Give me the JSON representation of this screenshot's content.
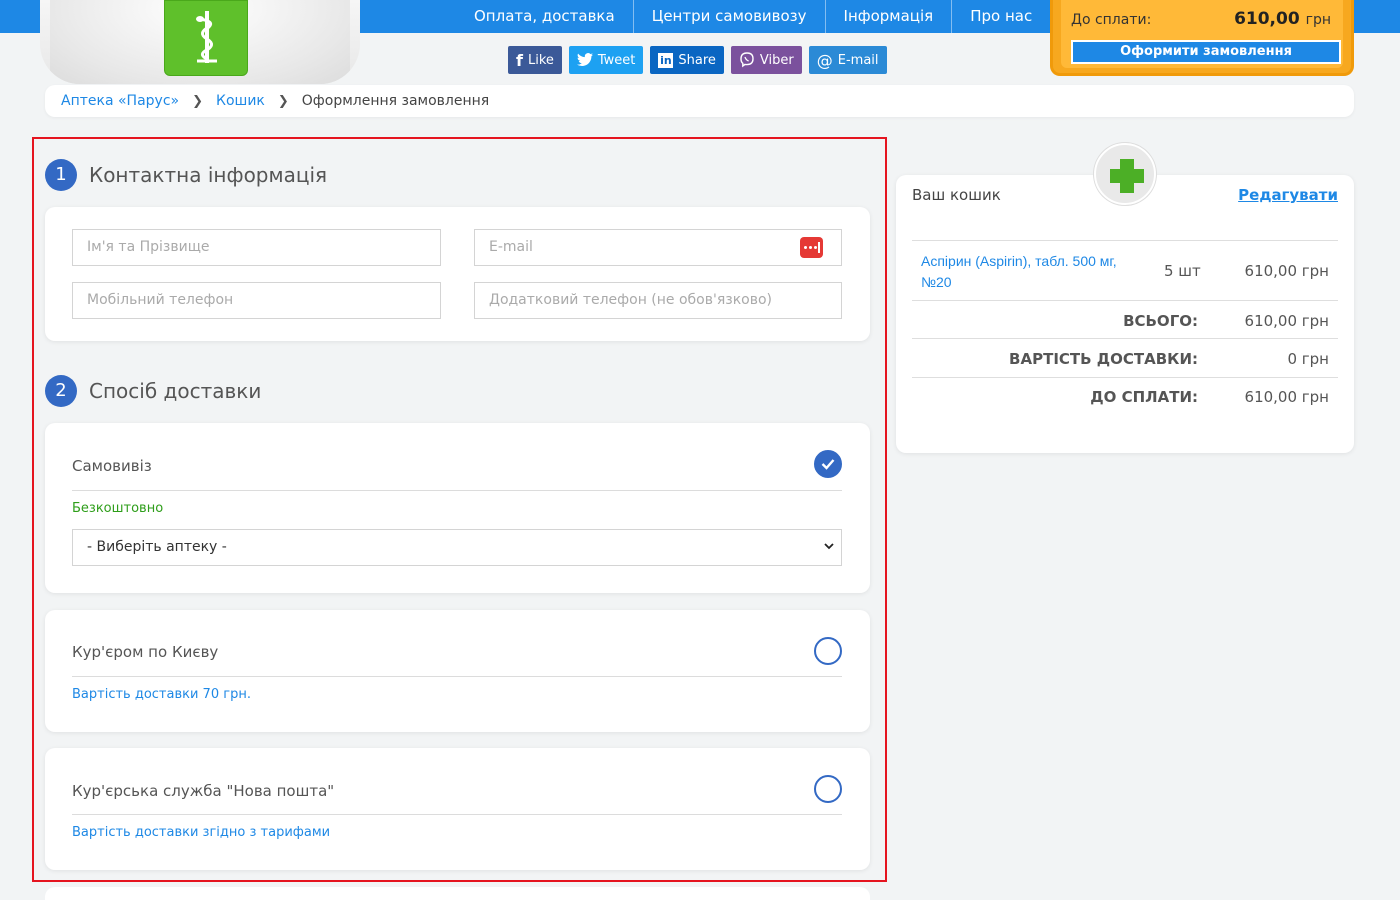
{
  "nav": [
    "Оплата, доставка",
    "Центри самовивозу",
    "Інформація",
    "Про нас"
  ],
  "social": [
    {
      "label": "Like",
      "icon": "facebook-icon"
    },
    {
      "label": "Tweet",
      "icon": "twitter-icon"
    },
    {
      "label": "Share",
      "icon": "linkedin-icon"
    },
    {
      "label": "Viber",
      "icon": "viber-icon"
    },
    {
      "label": "E-mail",
      "icon": "email-icon"
    }
  ],
  "cart_widget": {
    "label": "До сплати:",
    "amount": "610,00",
    "currency": "грн",
    "button": "Оформити замовлення"
  },
  "breadcrumb": {
    "home": "Аптека «Парус»",
    "cart": "Кошик",
    "current": "Оформлення замовлення"
  },
  "contact": {
    "num": "1",
    "title": "Контактна інформація",
    "name_placeholder": "Ім'я та Прізвище",
    "email_placeholder": "E-mail",
    "phone_placeholder": "Мобільний телефон",
    "phone2_placeholder": "Додатковий телефон (не обов'язково)"
  },
  "delivery": {
    "num": "2",
    "title": "Спосіб доставки",
    "options": [
      {
        "title": "Самовивіз",
        "note": "Безкоштовно",
        "selected": true,
        "select_value": "- Виберіть аптеку -"
      },
      {
        "title": "Кур'єром по Києву",
        "note": "Вартість доставки 70 грн.",
        "selected": false
      },
      {
        "title": "Кур'єрська служба \"Нова пошта\"",
        "note": "Вартість доставки згідно з тарифами",
        "selected": false
      }
    ]
  },
  "colors": {
    "primary": "#1e88e5",
    "step": "#3369c4",
    "free": "#2e9e1a",
    "highlight": "#e5141f",
    "widget": "#f7a81f"
  },
  "side_cart": {
    "title": "Ваш кошик",
    "edit": "Редагувати",
    "item": {
      "name": "Аспірин (Aspirin), табл. 500 мг, №20",
      "qty": "5 шт",
      "price": "610,00 грн"
    },
    "total_label": "ВСЬОГО:",
    "total": "610,00 грн",
    "delivery_label": "ВАРТІСТЬ ДОСТАВКИ:",
    "delivery": "0 грн",
    "pay_label": "ДО СПЛАТИ:",
    "pay": "610,00 грн"
  }
}
